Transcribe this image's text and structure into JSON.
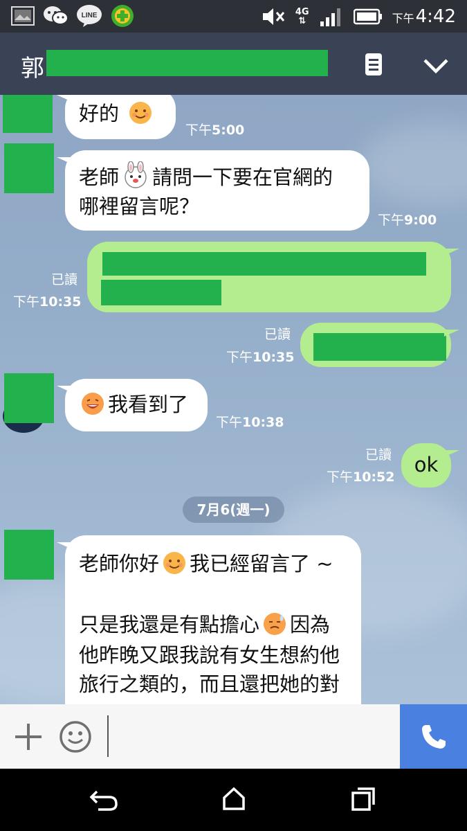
{
  "status_bar": {
    "ampm": "下午",
    "time": "4:42",
    "network": "4G",
    "icons": [
      "gallery-icon",
      "wechat-icon",
      "line-icon",
      "cleaner-app-icon",
      "mute-icon",
      "signal-icon",
      "battery-icon"
    ]
  },
  "header": {
    "title": "郭",
    "icons": [
      "notes-icon",
      "chevron-down-icon"
    ]
  },
  "messages": [
    {
      "id": "m1",
      "direction": "incoming",
      "text": "好的",
      "emoji": "smile-emoji",
      "time_ampm": "下午",
      "time": "5:00"
    },
    {
      "id": "m2",
      "direction": "incoming",
      "line1_a": "老師",
      "emoji": "rabbit-sticker-emoji",
      "line1_b": "請問一下要在官網的",
      "line2": "哪裡留言呢？",
      "time_ampm": "下午",
      "time": "9:00"
    },
    {
      "id": "m3",
      "direction": "outgoing",
      "read": "已讀",
      "time_ampm": "下午",
      "time": "10:35",
      "redacted": true
    },
    {
      "id": "m4",
      "direction": "outgoing",
      "read": "已讀",
      "time_ampm": "下午",
      "time": "10:35",
      "redacted": true
    },
    {
      "id": "m5",
      "direction": "incoming",
      "emoji": "grin-emoji",
      "text": "我看到了",
      "time_ampm": "下午",
      "time": "10:38"
    },
    {
      "id": "m6",
      "direction": "outgoing",
      "read": "已讀",
      "text": "ok",
      "time_ampm": "下午",
      "time": "10:52"
    },
    {
      "id": "m7",
      "direction": "incoming",
      "line1_a": "老師你好",
      "emoji1": "smile-emoji",
      "line1_b": "我已經留言了 ~",
      "line2_a": "只是我還是有點擔心",
      "emoji2": "sweat-emoji",
      "line2_b": "因為",
      "line3": "他昨晚又跟我說有女生想約他",
      "line4": "旅行之類的，而且還把她的對"
    }
  ],
  "date_separator": "7月6(週一)",
  "input_bar": {
    "placeholder": "",
    "icons": [
      "plus-icon",
      "emoji-icon",
      "phone-icon"
    ]
  },
  "nav_bar": {
    "icons": [
      "back-icon",
      "home-icon",
      "recent-apps-icon"
    ]
  },
  "colors": {
    "status_bar": "#2d3036",
    "header": "#3a4256",
    "outgoing_bubble": "#b4ed8f",
    "incoming_bubble": "#ffffff",
    "call_button": "#4a80e0",
    "redaction": "#22b14c"
  }
}
